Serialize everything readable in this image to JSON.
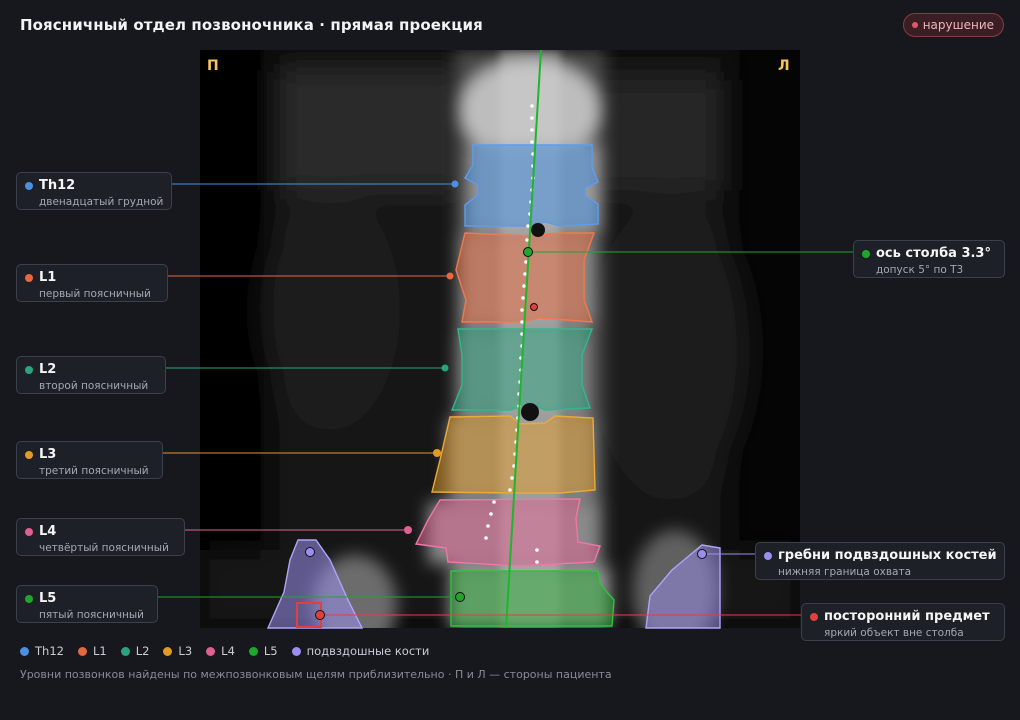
{
  "header": {
    "title": "Поясничный отдел позвоночника · прямая проекция",
    "badge": "нарушение"
  },
  "image": {
    "side_right": "П",
    "side_left": "Л"
  },
  "labels": {
    "th12": {
      "name": "Th12",
      "sub": "двенадцатый грудной",
      "color": "#4a8fe0"
    },
    "l1": {
      "name": "L1",
      "sub": "первый поясничный",
      "color": "#e8673c"
    },
    "l2": {
      "name": "L2",
      "sub": "второй поясничный",
      "color": "#2aa37e"
    },
    "l3": {
      "name": "L3",
      "sub": "третий поясничный",
      "color": "#e09a25"
    },
    "l4": {
      "name": "L4",
      "sub": "четвёртый поясничный",
      "color": "#e0608f"
    },
    "l5": {
      "name": "L5",
      "sub": "пятый поясничный",
      "color": "#1fa62c"
    },
    "axis": {
      "name": "ось столба 3.3°",
      "sub": "допуск 5° по Т3",
      "color": "#1fa62c"
    },
    "iliac": {
      "name": "гребни подвздошных костей",
      "sub": "нижняя граница охвата",
      "color": "#9a8ff0"
    },
    "foreign": {
      "name": "посторонний предмет",
      "sub": "яркий объект вне столба",
      "color": "#e04040"
    }
  },
  "legend": [
    {
      "label": "Th12",
      "color": "#4a8fe0"
    },
    {
      "label": "L1",
      "color": "#e8673c"
    },
    {
      "label": "L2",
      "color": "#2aa37e"
    },
    {
      "label": "L3",
      "color": "#e09a25"
    },
    {
      "label": "L4",
      "color": "#e0608f"
    },
    {
      "label": "L5",
      "color": "#1fa62c"
    },
    {
      "label": "подвздошные кости",
      "color": "#9a8ff0"
    }
  ],
  "footnote": "Уровни позвонков найдены по межпозвонковым щелям приблизительно · П и Л — стороны пациента"
}
